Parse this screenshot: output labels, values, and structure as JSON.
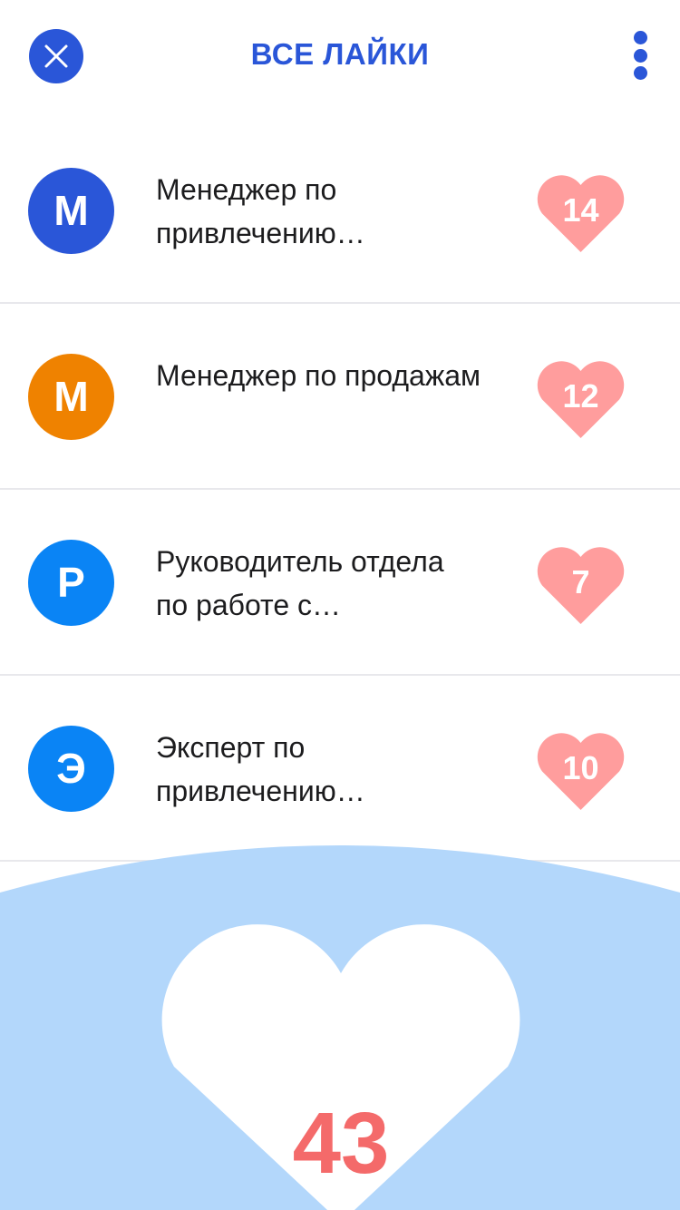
{
  "header": {
    "title": "ВСЕ ЛАЙКИ"
  },
  "colors": {
    "brand_blue": "#2a56d8",
    "heart_pink": "#ff9d9d",
    "total_red": "#f46a6a",
    "footer_blue": "#b3d7fb"
  },
  "items": [
    {
      "initial": "М",
      "title": "Менеджер по привлечению…",
      "likes": "14",
      "avatar_color": "#2a56d8"
    },
    {
      "initial": "М",
      "title": "Менеджер по продажам",
      "likes": "12",
      "avatar_color": "#ef8200"
    },
    {
      "initial": "Р",
      "title": "Руководитель отдела по работе с…",
      "likes": "7",
      "avatar_color": "#0a84f5"
    },
    {
      "initial": "Э",
      "title": "Эксперт по привлечению…",
      "likes": "10",
      "avatar_color": "#0a84f5"
    }
  ],
  "total": {
    "count": "43"
  },
  "icons": {
    "close": "close-icon",
    "more": "more-vertical-icon",
    "like": "heart-icon"
  }
}
